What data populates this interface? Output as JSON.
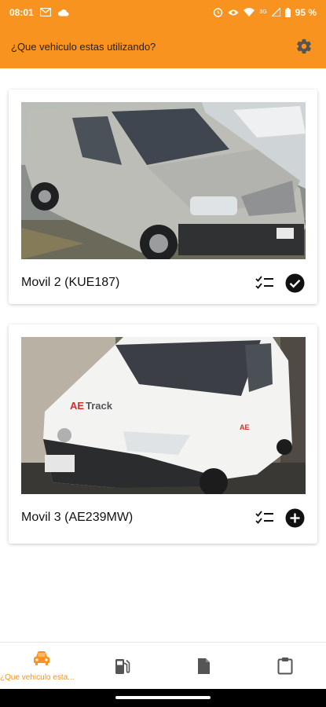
{
  "status_bar": {
    "time": "08:01",
    "network": "3G",
    "battery": "95 %",
    "icons": [
      "gmail-icon",
      "cloud-icon",
      "alarm-icon",
      "eye-icon",
      "wifi-icon",
      "signal-icon",
      "battery-icon"
    ]
  },
  "app_bar": {
    "title": "¿Que vehiculo estas utilizando?",
    "settings_icon": "gear-icon"
  },
  "vehicles": [
    {
      "name": "Movil 2 (KUE187)",
      "status": "selected",
      "status_icon": "check-circle-icon",
      "checklist_icon": "checklist-icon"
    },
    {
      "name": "Movil 3 (AE239MW)",
      "status": "not-selected",
      "status_icon": "add-circle-icon",
      "checklist_icon": "checklist-icon"
    }
  ],
  "bottom_nav": {
    "items": [
      {
        "label": "¿Que vehiculo esta...",
        "icon": "car-icon",
        "active": true
      },
      {
        "icon": "fuel-pump-icon",
        "active": false
      },
      {
        "icon": "document-icon",
        "active": false
      },
      {
        "icon": "clipboard-icon",
        "active": false
      }
    ]
  },
  "colors": {
    "accent": "#f7931e",
    "text": "#212121",
    "icon_dark": "#555555"
  }
}
